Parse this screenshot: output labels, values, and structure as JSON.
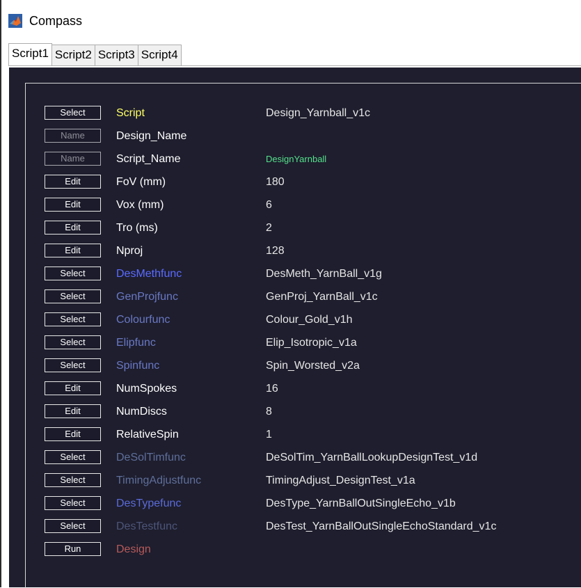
{
  "window": {
    "title": "Compass",
    "icon": "matlab-icon"
  },
  "tabs": [
    {
      "label": "Script1",
      "active": true
    },
    {
      "label": "Script2",
      "active": false
    },
    {
      "label": "Script3",
      "active": false
    },
    {
      "label": "Script4",
      "active": false
    }
  ],
  "colors": {
    "panel_bg": "#1e1e2e",
    "label_yellow": "#ffff66",
    "label_white": "#ffffff",
    "label_blue": "#5b6bff",
    "label_dimblue": "#6a79c4",
    "label_steel": "#5f6f9a",
    "label_red": "#b85a5a",
    "value_green": "#55e08a"
  },
  "rows": [
    {
      "button": "Select",
      "label": "Script",
      "value": "Design_Yarnball_v1c"
    },
    {
      "button": "Name",
      "label": "Design_Name",
      "value": ""
    },
    {
      "button": "Name",
      "label": "Script_Name",
      "value": "DesignYarnball"
    },
    {
      "button": "Edit",
      "label": "FoV (mm)",
      "value": "180"
    },
    {
      "button": "Edit",
      "label": "Vox (mm)",
      "value": "6"
    },
    {
      "button": "Edit",
      "label": "Tro (ms)",
      "value": "2"
    },
    {
      "button": "Edit",
      "label": "Nproj",
      "value": "128"
    },
    {
      "button": "Select",
      "label": "DesMethfunc",
      "value": "DesMeth_YarnBall_v1g"
    },
    {
      "button": "Select",
      "label": "GenProjfunc",
      "value": "GenProj_YarnBall_v1c"
    },
    {
      "button": "Select",
      "label": "Colourfunc",
      "value": "Colour_Gold_v1h"
    },
    {
      "button": "Select",
      "label": "Elipfunc",
      "value": "Elip_Isotropic_v1a"
    },
    {
      "button": "Select",
      "label": "Spinfunc",
      "value": "Spin_Worsted_v2a"
    },
    {
      "button": "Edit",
      "label": "NumSpokes",
      "value": "16"
    },
    {
      "button": "Edit",
      "label": "NumDiscs",
      "value": "8"
    },
    {
      "button": "Edit",
      "label": "RelativeSpin",
      "value": "1"
    },
    {
      "button": "Select",
      "label": "DeSolTimfunc",
      "value": "DeSolTim_YarnBallLookupDesignTest_v1d"
    },
    {
      "button": "Select",
      "label": "TimingAdjustfunc",
      "value": "TimingAdjust_DesignTest_v1a"
    },
    {
      "button": "Select",
      "label": "DesTypefunc",
      "value": "DesType_YarnBallOutSingleEcho_v1b"
    },
    {
      "button": "Select",
      "label": "DesTestfunc",
      "value": "DesTest_YarnBallOutSingleEchoStandard_v1c"
    },
    {
      "button": "Run",
      "label": "Design",
      "value": ""
    }
  ]
}
